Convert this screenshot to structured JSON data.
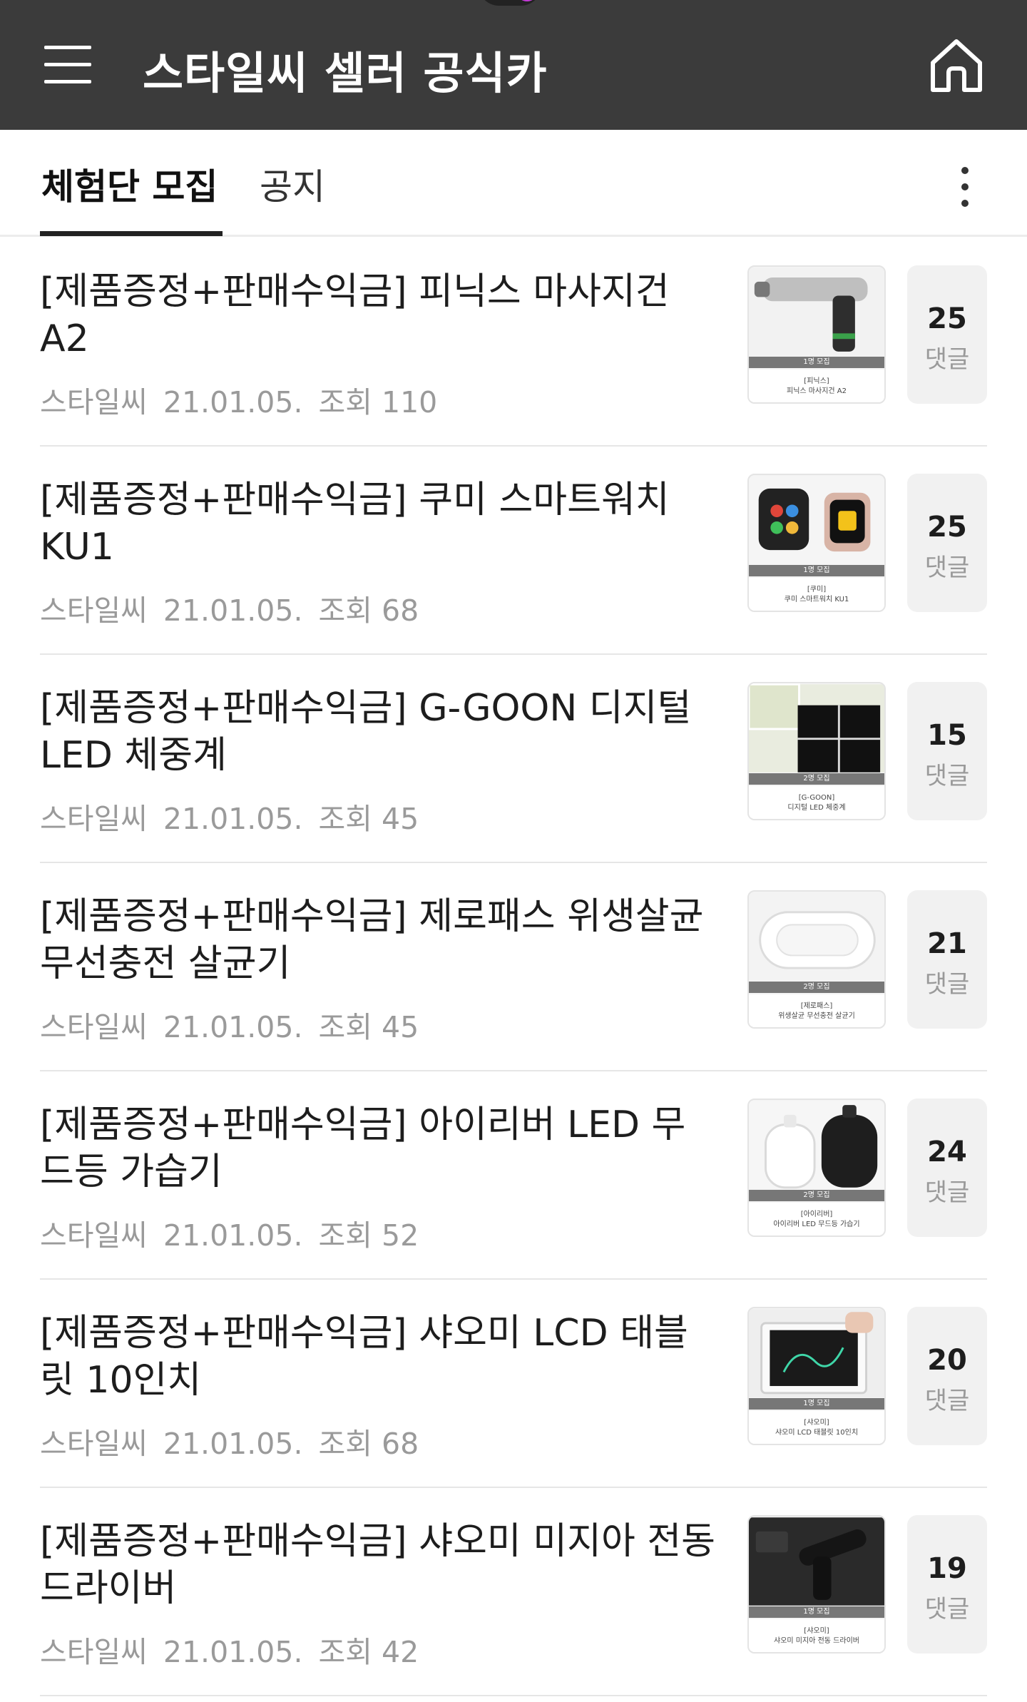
{
  "app_bar": {
    "title": "스타일씨 셀러 공식카"
  },
  "tabs": [
    {
      "label": "체험단 모집",
      "active": true
    },
    {
      "label": "공지",
      "active": false
    }
  ],
  "posts": [
    {
      "title": "[제품증정+판매수익금] 피닉스 마사지건 A2",
      "author": "스타일씨",
      "date": "21.01.05.",
      "views": "조회 110",
      "comments": "25",
      "comments_label": "댓글",
      "thumb_band": "1명 모집",
      "thumb_caption_1": "[피닉스]",
      "thumb_caption_2": "피닉스 마사지건 A2"
    },
    {
      "title": "[제품증정+판매수익금] 쿠미 스마트워치 KU1",
      "author": "스타일씨",
      "date": "21.01.05.",
      "views": "조회 68",
      "comments": "25",
      "comments_label": "댓글",
      "thumb_band": "1명 모집",
      "thumb_caption_1": "[쿠미]",
      "thumb_caption_2": "쿠미 스마트워치 KU1"
    },
    {
      "title": "[제품증정+판매수익금] G-GOON 디지털 LED 체중계",
      "author": "스타일씨",
      "date": "21.01.05.",
      "views": "조회 45",
      "comments": "15",
      "comments_label": "댓글",
      "thumb_band": "2명 모집",
      "thumb_caption_1": "[G-GOON]",
      "thumb_caption_2": "디지털 LED 체중계"
    },
    {
      "title": "[제품증정+판매수익금] 제로패스 위생살균 무선충전 살균기",
      "author": "스타일씨",
      "date": "21.01.05.",
      "views": "조회 45",
      "comments": "21",
      "comments_label": "댓글",
      "thumb_band": "2명 모집",
      "thumb_caption_1": "[제로패스]",
      "thumb_caption_2": "위생살균 무선충전 살균기"
    },
    {
      "title": "[제품증정+판매수익금] 아이리버 LED 무드등 가습기",
      "author": "스타일씨",
      "date": "21.01.05.",
      "views": "조회 52",
      "comments": "24",
      "comments_label": "댓글",
      "thumb_band": "2명 모집",
      "thumb_caption_1": "[아이리버]",
      "thumb_caption_2": "아이리버 LED 무드등 가습기"
    },
    {
      "title": "[제품증정+판매수익금] 샤오미 LCD 태블릿 10인치",
      "author": "스타일씨",
      "date": "21.01.05.",
      "views": "조회 68",
      "comments": "20",
      "comments_label": "댓글",
      "thumb_band": "1명 모집",
      "thumb_caption_1": "[샤오미]",
      "thumb_caption_2": "샤오미 LCD 태블릿 10인치"
    },
    {
      "title": "[제품증정+판매수익금] 샤오미 미지아 전동 드라이버",
      "author": "스타일씨",
      "date": "21.01.05.",
      "views": "조회 42",
      "comments": "19",
      "comments_label": "댓글",
      "thumb_band": "1명 모집",
      "thumb_caption_1": "[샤오미]",
      "thumb_caption_2": "샤오미 미지아 전동 드라이버"
    }
  ]
}
